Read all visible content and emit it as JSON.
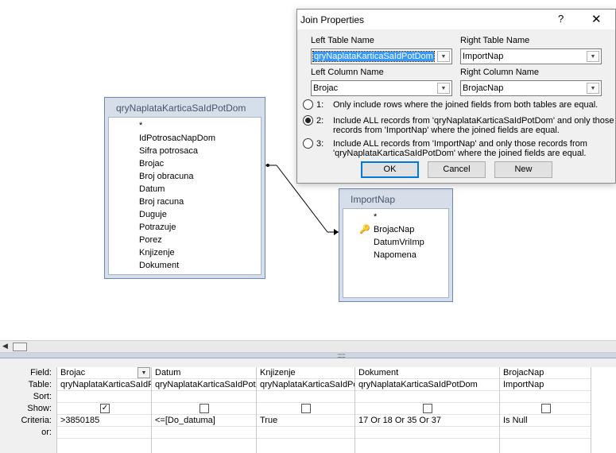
{
  "designer": {
    "table1": {
      "title": "qryNaplataKarticaSaIdPotDom",
      "fields": [
        "*",
        "IdPotrosacNapDom",
        "Sifra potrosaca",
        "Brojac",
        "Broj obracuna",
        "Datum",
        "Broj racuna",
        "Duguje",
        "Potrazuje",
        "Porez",
        "Knjizenje",
        "Dokument"
      ]
    },
    "table2": {
      "title": "ImportNap",
      "fields": [
        "*",
        "BrojacNap",
        "DatumVriImp",
        "Napomena"
      ]
    }
  },
  "dialog": {
    "title": "Join Properties",
    "help": "?",
    "close": "✕",
    "left_table_label": "Left Table Name",
    "left_table_value": "qryNaplataKarticaSaIdPotDom",
    "right_table_label": "Right Table Name",
    "right_table_value": "ImportNap",
    "left_column_label": "Left Column Name",
    "left_column_value": "Brojac",
    "right_column_label": "Right Column Name",
    "right_column_value": "BrojacNap",
    "options": [
      {
        "num": "1:",
        "line1": "Only include rows where the joined fields from both tables are equal.",
        "line2": "",
        "selected": false
      },
      {
        "num": "2:",
        "line1": "Include ALL records from 'qryNaplataKarticaSaIdPotDom' and only those",
        "line2": "records from 'ImportNap' where the joined fields are equal.",
        "selected": true
      },
      {
        "num": "3:",
        "line1": "Include ALL records from 'ImportNap' and only those records from",
        "line2": "'qryNaplataKarticaSaIdPotDom' where the joined fields are equal.",
        "selected": false
      }
    ],
    "ok": "OK",
    "cancel": "Cancel",
    "new": "New"
  },
  "grid": {
    "row_labels": [
      "Field:",
      "Table:",
      "Sort:",
      "Show:",
      "Criteria:",
      "or:"
    ],
    "columns": [
      {
        "field": "Brojac",
        "table": "qryNaplataKarticaSaIdPotDom",
        "sort": "",
        "show": true,
        "criteria": ">3850185",
        "or": ""
      },
      {
        "field": "Datum",
        "table": "qryNaplataKarticaSaIdPotDom",
        "sort": "",
        "show": false,
        "criteria": "<=[Do_datuma]",
        "or": ""
      },
      {
        "field": "Knjizenje",
        "table": "qryNaplataKarticaSaIdPotDom",
        "sort": "",
        "show": false,
        "criteria": "True",
        "or": ""
      },
      {
        "field": "Dokument",
        "table": "qryNaplataKarticaSaIdPotDom",
        "sort": "",
        "show": false,
        "criteria": "17 Or 18 Or 35 Or 37",
        "or": ""
      },
      {
        "field": "BrojacNap",
        "table": "ImportNap",
        "sort": "",
        "show": false,
        "criteria": "Is Null",
        "or": ""
      }
    ]
  },
  "scroll": {
    "left_arrow": "◀",
    "grip": "::::::::"
  },
  "icons": {
    "key": "primary-key-icon",
    "dropdown": "chevron-down-icon"
  }
}
